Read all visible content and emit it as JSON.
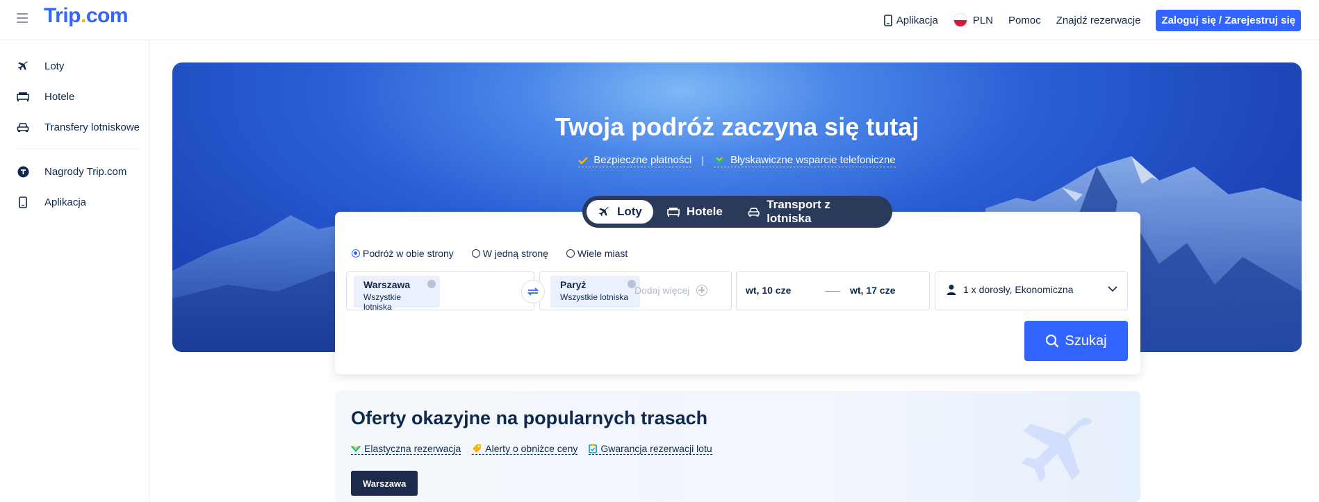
{
  "header": {
    "logo": {
      "main": "Trip",
      "dot": ".",
      "tld": "com"
    },
    "nav": {
      "app": "Aplikacja",
      "currency": "PLN",
      "help": "Pomoc",
      "find_booking": "Znajdź rezerwacje",
      "login": "Zaloguj się / Zarejestruj się"
    }
  },
  "sidebar": {
    "items": [
      {
        "label": "Loty",
        "icon": "plane-icon"
      },
      {
        "label": "Hotele",
        "icon": "bed-icon"
      },
      {
        "label": "Transfery lotniskowe",
        "icon": "car-icon"
      },
      {
        "label": "Nagrody Trip.com",
        "icon": "trip-rewards-icon"
      },
      {
        "label": "Aplikacja",
        "icon": "phone-icon"
      }
    ]
  },
  "hero": {
    "title": "Twoja podróż zaczyna się tutaj",
    "features": [
      "Bezpieczne płatności",
      "Błyskawiczne wsparcie telefoniczne"
    ],
    "separator": "|"
  },
  "mode_tabs": [
    {
      "label": "Loty",
      "active": true
    },
    {
      "label": "Hotele",
      "active": false
    },
    {
      "label": "Transport z lotniska",
      "active": false
    }
  ],
  "search": {
    "trip_types": [
      {
        "label": "Podróż w obie strony",
        "selected": true
      },
      {
        "label": "W jedną stronę",
        "selected": false
      },
      {
        "label": "Wiele miast",
        "selected": false
      }
    ],
    "from": {
      "city": "Warszawa",
      "sub": "Wszystkie lotniska"
    },
    "to": {
      "city": "Paryż",
      "sub": "Wszystkie lotniska"
    },
    "add_more": "Dodaj więcej",
    "depart_date": "wt, 10 cze",
    "return_date": "wt, 17 cze",
    "passengers": "1 x dorosły, Ekonomiczna",
    "search_button": "Szukaj"
  },
  "deals": {
    "title": "Oferty okazyjne na popularnych trasach",
    "features": [
      "Elastyczna rezerwacja",
      "Alerty o obniżce ceny",
      "Gwarancja rezerwacji lotu"
    ],
    "city_button": "Warszawa"
  },
  "colors": {
    "brand": "#3264ff",
    "navy": "#0f294d",
    "accent_yellow": "#ffb400"
  }
}
